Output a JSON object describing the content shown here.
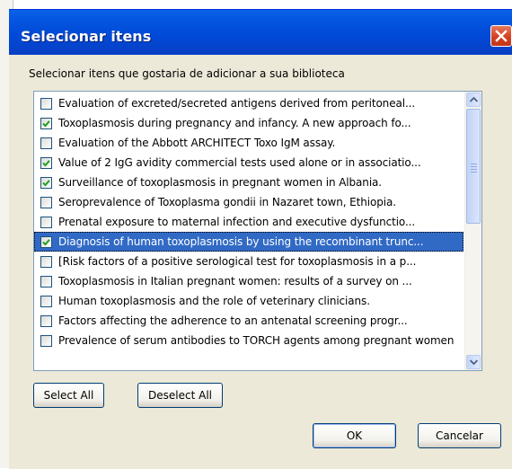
{
  "dialog": {
    "title": "Selecionar itens",
    "instruction": "Selecionar itens que gostaria de adicionar a sua biblioteca"
  },
  "items": [
    {
      "label": "Evaluation of excreted/secreted antigens derived from peritoneal...",
      "checked": false
    },
    {
      "label": "Toxoplasmosis during pregnancy and infancy. A new approach fo...",
      "checked": true
    },
    {
      "label": "Evaluation of the Abbott ARCHITECT Toxo IgM assay.",
      "checked": false
    },
    {
      "label": "Value of 2 IgG avidity commercial tests used alone or in associatio...",
      "checked": true
    },
    {
      "label": "Surveillance of toxoplasmosis in pregnant women in Albania.",
      "checked": true
    },
    {
      "label": "Seroprevalence of Toxoplasma gondii in Nazaret town, Ethiopia.",
      "checked": false
    },
    {
      "label": "Prenatal exposure to maternal infection and executive dysfunctio...",
      "checked": false
    },
    {
      "label": "Diagnosis of human toxoplasmosis by using the recombinant trunc...",
      "checked": true,
      "selected": true
    },
    {
      "label": "[Risk factors of a positive serological test for toxoplasmosis in a p...",
      "checked": false
    },
    {
      "label": "Toxoplasmosis in Italian pregnant women: results of a survey on ...",
      "checked": false
    },
    {
      "label": "Human toxoplasmosis and the role of veterinary clinicians.",
      "checked": false
    },
    {
      "label": "Factors affecting the adherence to an antenatal screening progr...",
      "checked": false
    },
    {
      "label": "Prevalence of serum antibodies to TORCH agents among pregnant women",
      "checked": false
    }
  ],
  "buttons": {
    "select_all": "Select All",
    "deselect_all": "Deselect All",
    "ok": "OK",
    "cancel": "Cancelar"
  },
  "colors": {
    "title_bar": "#0049d6",
    "selection": "#316ac5",
    "check": "#21a121",
    "close": "#d4411e"
  },
  "icons": {
    "close": "close-icon",
    "scroll_up": "chevron-up-icon",
    "scroll_down": "chevron-down-icon",
    "check": "check-icon"
  }
}
